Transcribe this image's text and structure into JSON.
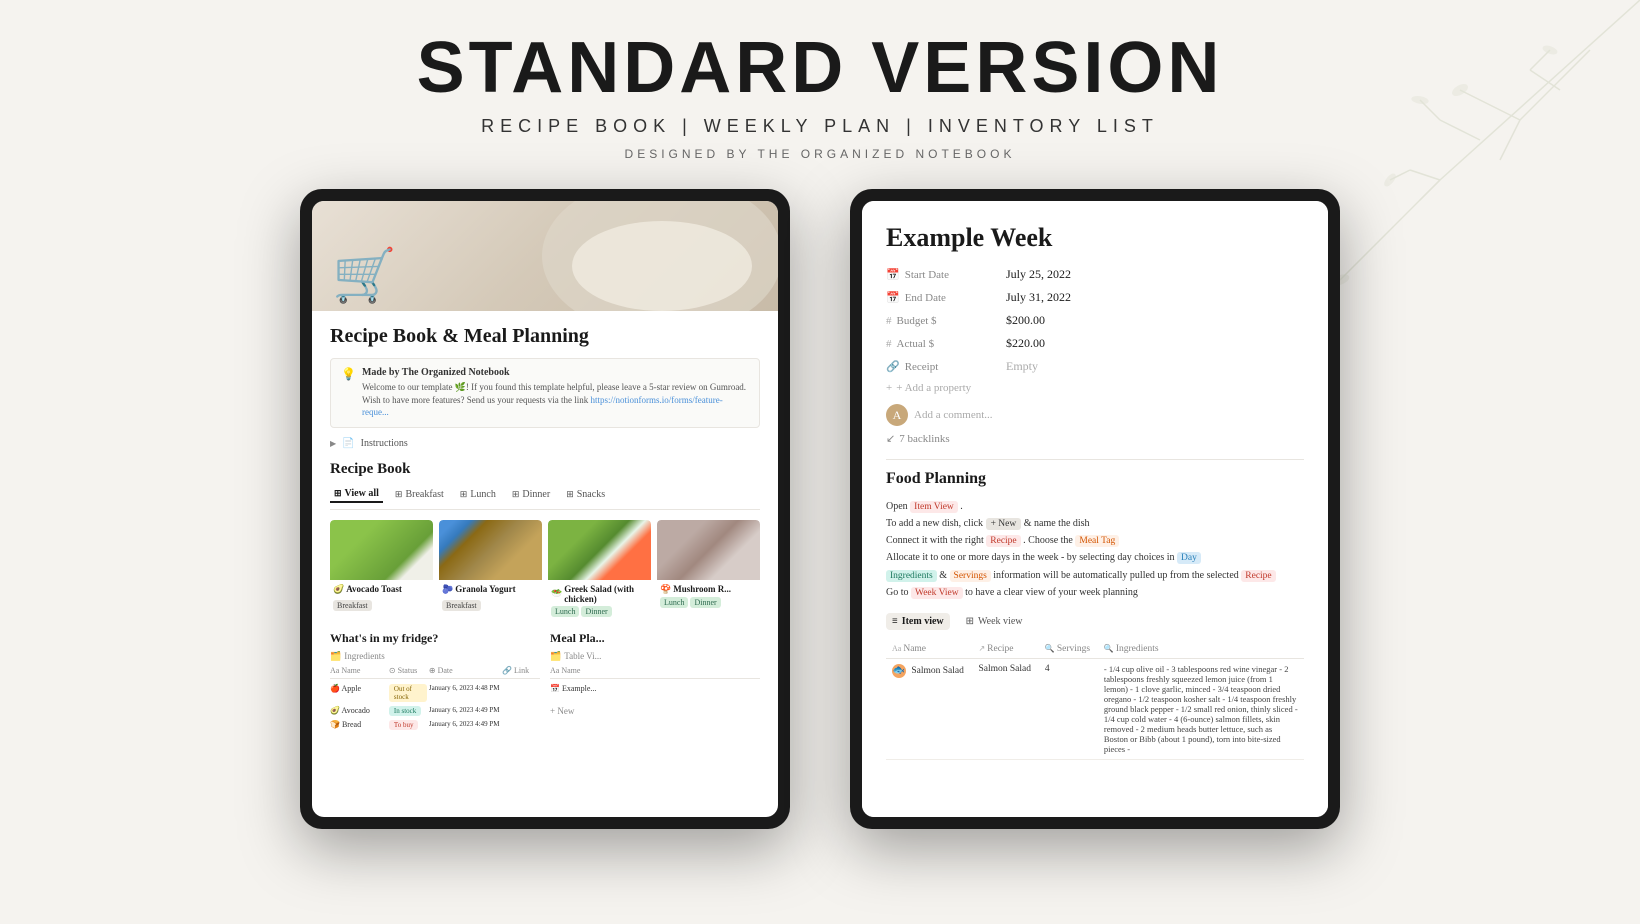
{
  "header": {
    "main_title": "STANDARD VERSION",
    "subtitle": "RECIPE BOOK  |  WEEKLY PLAN  |  INVENTORY LIST",
    "designer": "DESIGNED BY THE ORGANIZED NOTEBOOK"
  },
  "left_tablet": {
    "hero_emoji": "🛒",
    "page_title": "Recipe Book & Meal Planning",
    "callout": {
      "title": "Made by The Organized Notebook",
      "text_1": "Welcome to our template 🌿! If you found this template helpful, please leave a 5-star review on Gumroad.",
      "text_2": "Wish to have more features? Send us your requests via the link ",
      "link": "https://notionforms.io/forms/feature-reque..."
    },
    "instructions_label": "Instructions",
    "recipe_book_title": "Recipe Book",
    "tabs": [
      {
        "label": "View all",
        "active": true
      },
      {
        "label": "Breakfast"
      },
      {
        "label": "Lunch"
      },
      {
        "label": "Dinner"
      },
      {
        "label": "Snacks"
      }
    ],
    "recipes": [
      {
        "name": "Avocado Toast",
        "tag": "Breakfast",
        "tag_type": "breakfast",
        "emoji": "🥑"
      },
      {
        "name": "Granola Yogurt",
        "tag": "Breakfast",
        "tag_type": "breakfast",
        "emoji": "🫐"
      },
      {
        "name": "Greek Salad (with chicken)",
        "tag1": "Lunch",
        "tag2": "Dinner",
        "tag_type": "lunch",
        "emoji": "🥗"
      },
      {
        "name": "Mushroom R...",
        "tag1": "Lunch",
        "tag2": "Dinner",
        "tag_type": "dinner",
        "emoji": "🍄"
      }
    ],
    "fridge_title": "What's in my fridge?",
    "fridge_subtitle": "Ingredients",
    "fridge_columns": [
      "Name",
      "Status",
      "Date",
      "Link"
    ],
    "fridge_rows": [
      {
        "name": "Apple",
        "emoji": "🍎",
        "status": "Out of stock",
        "status_type": "out",
        "date": "January 6, 2023 4:48 PM"
      },
      {
        "name": "Avocado",
        "emoji": "🥑",
        "status": "In stock",
        "status_type": "in",
        "date": "January 6, 2023 4:49 PM"
      },
      {
        "name": "Bread",
        "emoji": "🍞",
        "status": "To buy",
        "status_type": "to-buy",
        "date": "January 6, 2023 4:49 PM"
      }
    ],
    "meal_title": "Meal Pla...",
    "meal_subtitle": "Table Vi..."
  },
  "right_tablet": {
    "week_title": "Example Week",
    "properties": [
      {
        "label": "Start Date",
        "icon": "📅",
        "value": "July 25, 2022"
      },
      {
        "label": "End Date",
        "icon": "📅",
        "value": "July 31, 2022"
      },
      {
        "label": "Budget $",
        "icon": "#",
        "value": "$200.00"
      },
      {
        "label": "Actual $",
        "icon": "#",
        "value": "$220.00"
      },
      {
        "label": "Receipt",
        "icon": "🔗",
        "value": "Empty"
      }
    ],
    "add_property": "+ Add a property",
    "comment_placeholder": "Add a comment...",
    "backlinks": "7 backlinks",
    "food_planning_title": "Food Planning",
    "instructions": {
      "line1_pre": "Open ",
      "line1_highlight": "Item View",
      "line1_post": ".",
      "line2_pre": "To add a new dish, click ",
      "line2_new": "+ New",
      "line2_post": " & name the dish",
      "line3_pre": "Connect it with the right ",
      "line3_recipe": "Recipe",
      "line3_post": ". Choose the ",
      "line3_meal": "Meal Tag",
      "line4_pre": "Allocate it to one or more days in the week - by selecting day choices in ",
      "line4_day": "Day",
      "line5_pre": "",
      "line5_ingredients": "Ingredients",
      "line5_and": " & ",
      "line5_servings": "Servings",
      "line5_post": " information will be automatically pulled up from the selected ",
      "line5_recipe": "Recipe",
      "line6_pre": "Go to ",
      "line6_week": "Week View",
      "line6_post": " to have a clear view of your week planning"
    },
    "view_tabs": [
      {
        "label": "Item view",
        "icon": "≡",
        "active": true
      },
      {
        "label": "Week view",
        "icon": "⊞"
      }
    ],
    "table_columns": [
      "Name",
      "Recipe",
      "Servings",
      "Ingredients"
    ],
    "table_rows": [
      {
        "name": "Salmon Salad",
        "emoji": "🐟",
        "recipe": "Salmon Salad",
        "servings": "4",
        "ingredients": "- 1/4 cup olive oil - 3 tablespoons red wine vinegar - 2 tablespoons freshly squeezed lemon juice (from 1 lemon) - 1 clove garlic, minced - 3/4 teaspoon dried oregano - 1/2 teaspoon kosher salt - 1/4 teaspoon freshly ground black pepper - 1/2 small red onion, thinly sliced - 1/4 cup cold water - 4 (6-ounce) salmon fillets, skin removed - 2 medium heads butter lettuce, such as Boston or Bibb (about 1 pound), torn into bite-sized pieces -"
      }
    ]
  }
}
